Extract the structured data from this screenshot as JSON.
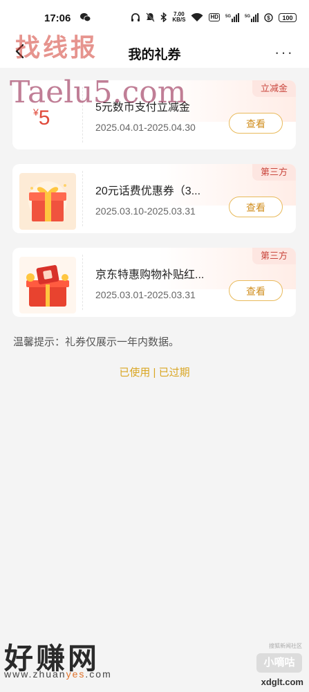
{
  "status_bar": {
    "time": "17:06",
    "network_speed": "7.00",
    "network_unit": "KB/S",
    "hd_label": "HD",
    "signal1_label": "5G",
    "signal2_label": "5G",
    "battery": "100",
    "icons": [
      "wechat-icon",
      "headphone-icon",
      "mute-icon",
      "bluetooth-icon",
      "wifi-icon",
      "signal-icon",
      "battery-icon"
    ]
  },
  "nav": {
    "title": "我的礼券",
    "more": "···"
  },
  "watermarks": {
    "top": "找线报",
    "overlay": "Taelu5.com",
    "bottom_brand": "好赚网",
    "bottom_url_prefix": "www.zhuan",
    "bottom_url_accent": "yes",
    "bottom_url_suffix": ".com",
    "bottom_right_small": "搜狐新闻社区",
    "bottom_right_logo": "小嘀咕",
    "bottom_right_url": "xdglt.com"
  },
  "coupons": [
    {
      "tag": "立减金",
      "value_symbol": "¥",
      "value": "5",
      "title": "5元数币支付立减金",
      "date": "2025.04.01-2025.04.30",
      "button": "查看"
    },
    {
      "tag": "第三方",
      "title": "20元话费优惠券（3...",
      "date": "2025.03.10-2025.03.31",
      "button": "查看"
    },
    {
      "tag": "第三方",
      "title": "京东特惠购物补贴红...",
      "date": "2025.03.01-2025.03.31",
      "button": "查看"
    }
  ],
  "tip": "温馨提示：礼券仅展示一年内数据。",
  "footer_links": {
    "used": "已使用",
    "separator": " | ",
    "expired": "已过期"
  },
  "colors": {
    "accent_gold": "#d08e1e",
    "tag_red": "#c9463d",
    "tag_bg": "#fde6e1",
    "value_red": "#e04b3c"
  }
}
